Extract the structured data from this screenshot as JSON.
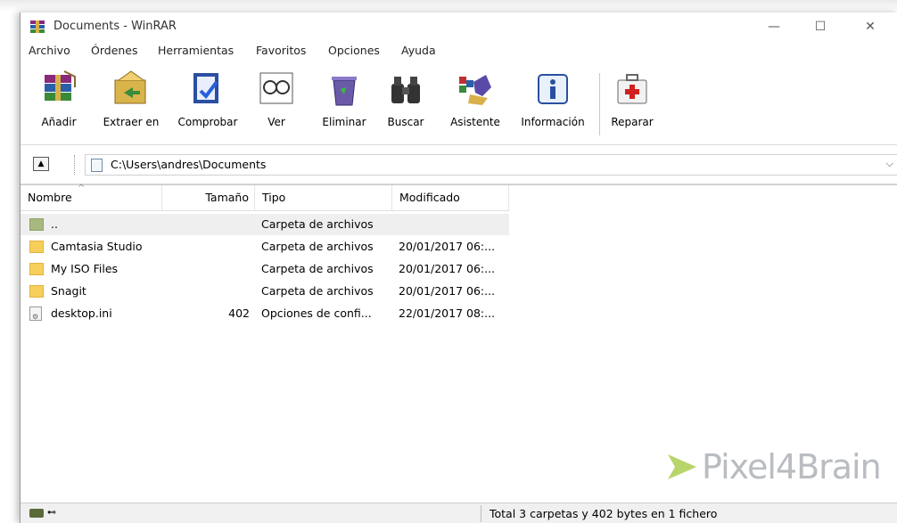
{
  "window": {
    "title": "Documents - WinRAR"
  },
  "window_controls": {
    "minimize": "—",
    "maximize": "☐",
    "close": "✕"
  },
  "menu": [
    "Archivo",
    "Órdenes",
    "Herramientas",
    "Favoritos",
    "Opciones",
    "Ayuda"
  ],
  "toolbar": {
    "buttons": [
      "Añadir",
      "Extraer en",
      "Comprobar",
      "Ver",
      "Eliminar",
      "Buscar",
      "Asistente",
      "Información",
      "Reparar"
    ]
  },
  "address": {
    "path": "C:\\Users\\andres\\Documents"
  },
  "columns": {
    "name": "Nombre",
    "size": "Tamaño",
    "type": "Tipo",
    "modified": "Modificado"
  },
  "files": [
    {
      "name": "..",
      "size": "",
      "type": "Carpeta de archivos",
      "modified": "",
      "icon": "folder-up-icon"
    },
    {
      "name": "Camtasia Studio",
      "size": "",
      "type": "Carpeta de archivos",
      "modified": "20/01/2017 06:...",
      "icon": "folder-icon"
    },
    {
      "name": "My ISO Files",
      "size": "",
      "type": "Carpeta de archivos",
      "modified": "20/01/2017 06:...",
      "icon": "folder-icon"
    },
    {
      "name": "Snagit",
      "size": "",
      "type": "Carpeta de archivos",
      "modified": "20/01/2017 06:...",
      "icon": "folder-icon"
    },
    {
      "name": "desktop.ini",
      "size": "402",
      "type": "Opciones de confi...",
      "modified": "22/01/2017 08:...",
      "icon": "settings-file-icon"
    }
  ],
  "status": {
    "text": "Total 3 carpetas y 402 bytes en 1 fichero"
  },
  "watermark": {
    "text": "Pixel4Brain"
  },
  "colors": {
    "folder": "#f6cf5a",
    "selection": "#efefef",
    "statusbar": "#f0f0f0",
    "watermark": "#b9bcc0"
  }
}
